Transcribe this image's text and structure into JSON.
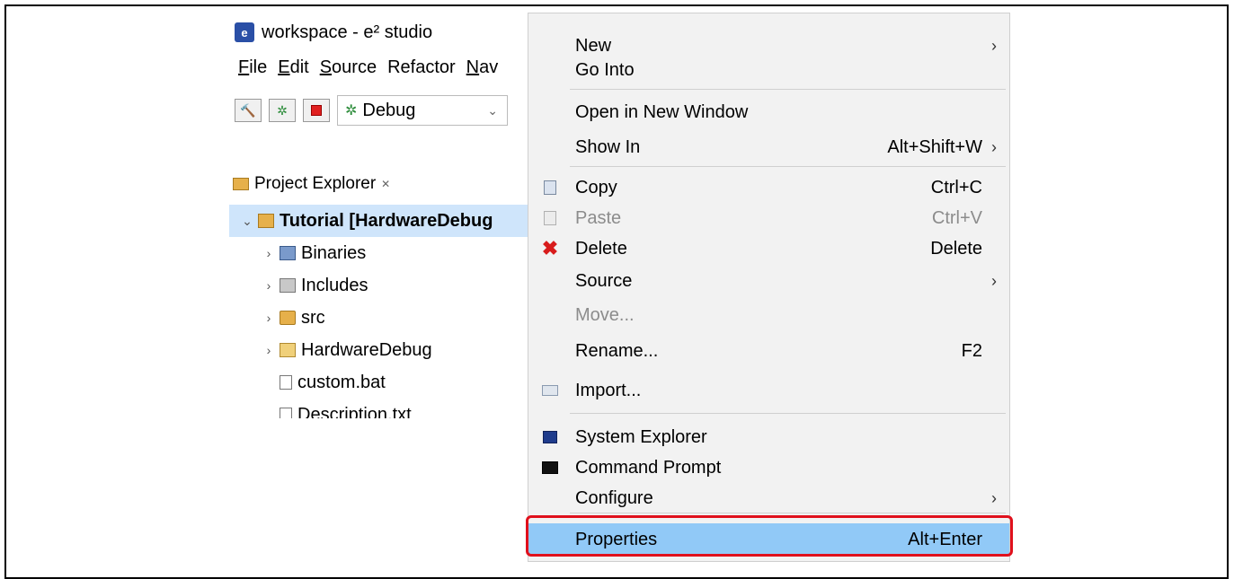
{
  "window": {
    "title": "workspace - e² studio",
    "menu": [
      {
        "u": "F",
        "rest": "ile"
      },
      {
        "u": "E",
        "rest": "dit"
      },
      {
        "u": "S",
        "rest": "ource"
      },
      {
        "u": "",
        "rest": "Refactor"
      },
      {
        "u": "N",
        "rest": "av"
      }
    ],
    "toolbar": {
      "config_value": "Debug"
    }
  },
  "project_explorer": {
    "tab_label": "Project Explorer",
    "tab_close": "✕",
    "items": [
      {
        "label": "Tutorial [HardwareDebug",
        "chev": "⌄",
        "level": 0,
        "selected": true,
        "icon": "project-icon"
      },
      {
        "label": "Binaries",
        "chev": "›",
        "level": 1,
        "icon": "binaries-icon"
      },
      {
        "label": "Includes",
        "chev": "›",
        "level": 1,
        "icon": "includes-icon"
      },
      {
        "label": "src",
        "chev": "›",
        "level": 1,
        "icon": "source-folder-icon"
      },
      {
        "label": "HardwareDebug",
        "chev": "›",
        "level": 1,
        "icon": "folder-icon"
      },
      {
        "label": "custom.bat",
        "chev": "",
        "level": 1,
        "icon": "file-icon"
      },
      {
        "label": "Description.txt",
        "chev": "",
        "level": 1,
        "icon": "file-icon"
      }
    ]
  },
  "context_menu": {
    "items": [
      {
        "label": "New",
        "submenu": true
      },
      {
        "label": "Go Into"
      },
      {
        "separator": true
      },
      {
        "label": "Open in New Window"
      },
      {
        "label": "Show In",
        "shortcut": "Alt+Shift+W",
        "submenu": true
      },
      {
        "separator": true
      },
      {
        "label": "Copy",
        "shortcut": "Ctrl+C",
        "icon": "copy-icon"
      },
      {
        "label": "Paste",
        "shortcut": "Ctrl+V",
        "icon": "paste-icon",
        "disabled": true
      },
      {
        "label": "Delete",
        "shortcut": "Delete",
        "icon": "delete-icon"
      },
      {
        "label": "Source",
        "submenu": true
      },
      {
        "label": "Move...",
        "disabled": true
      },
      {
        "label": "Rename...",
        "shortcut": "F2"
      },
      {
        "label": "Import...",
        "icon": "import-icon"
      },
      {
        "separator": true
      },
      {
        "label": "System Explorer",
        "icon": "system-explorer-icon"
      },
      {
        "label": "Command Prompt",
        "icon": "command-prompt-icon"
      },
      {
        "label": "Configure",
        "submenu": true
      },
      {
        "separator": true
      },
      {
        "label": "Properties",
        "shortcut": "Alt+Enter",
        "highlighted": true
      }
    ]
  }
}
